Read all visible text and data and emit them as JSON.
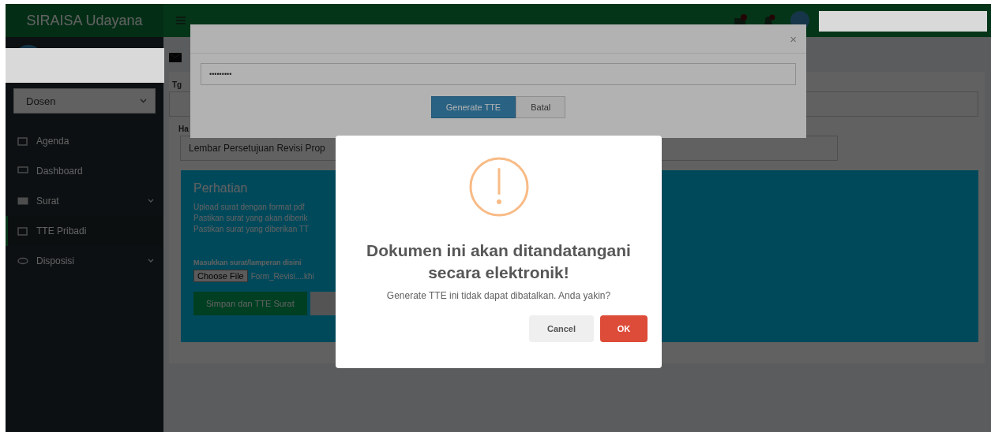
{
  "header": {
    "brand": "SIRAISA Udayana"
  },
  "sidebar": {
    "role_select": {
      "value": "Dosen"
    },
    "items": [
      {
        "label": "Agenda",
        "selected": false,
        "has_submenu": false
      },
      {
        "label": "Dashboard",
        "selected": false,
        "has_submenu": false
      },
      {
        "label": "Surat",
        "selected": false,
        "has_submenu": true
      },
      {
        "label": "TTE Pribadi",
        "selected": true,
        "has_submenu": false
      },
      {
        "label": "Disposisi",
        "selected": false,
        "has_submenu": true
      }
    ]
  },
  "page": {
    "fields": [
      {
        "label": "Tg"
      },
      {
        "label": "Ha",
        "value": "Lembar Persetujuan Revisi Prop"
      }
    ],
    "notice": {
      "title": "Perhatian",
      "lines": [
        "Upload surat dengan format pdf",
        "Pastikan surat yang akan diberik",
        "Pastikan surat yang diberikan TT"
      ]
    },
    "upload": {
      "label": "Masukkan surat/lamperan disini",
      "button": "Choose File",
      "file_name": "Form_Revisi....khi"
    },
    "submit_button": "Simpan dan TTE Surat"
  },
  "passphrase_modal": {
    "close": "×",
    "password": "•••••••••",
    "buttons": [
      {
        "label": "Generate TTE",
        "kind": "primary"
      },
      {
        "label": "Batal",
        "kind": "default"
      }
    ]
  },
  "alert": {
    "title": "Dokumen ini akan ditandatangani secara elektronik!",
    "text": "Generate TTE ini tidak dapat dibatalkan. Anda yakin?",
    "buttons": [
      {
        "label": "Cancel",
        "kind": "cancel"
      },
      {
        "label": "OK",
        "kind": "confirm"
      }
    ]
  }
}
